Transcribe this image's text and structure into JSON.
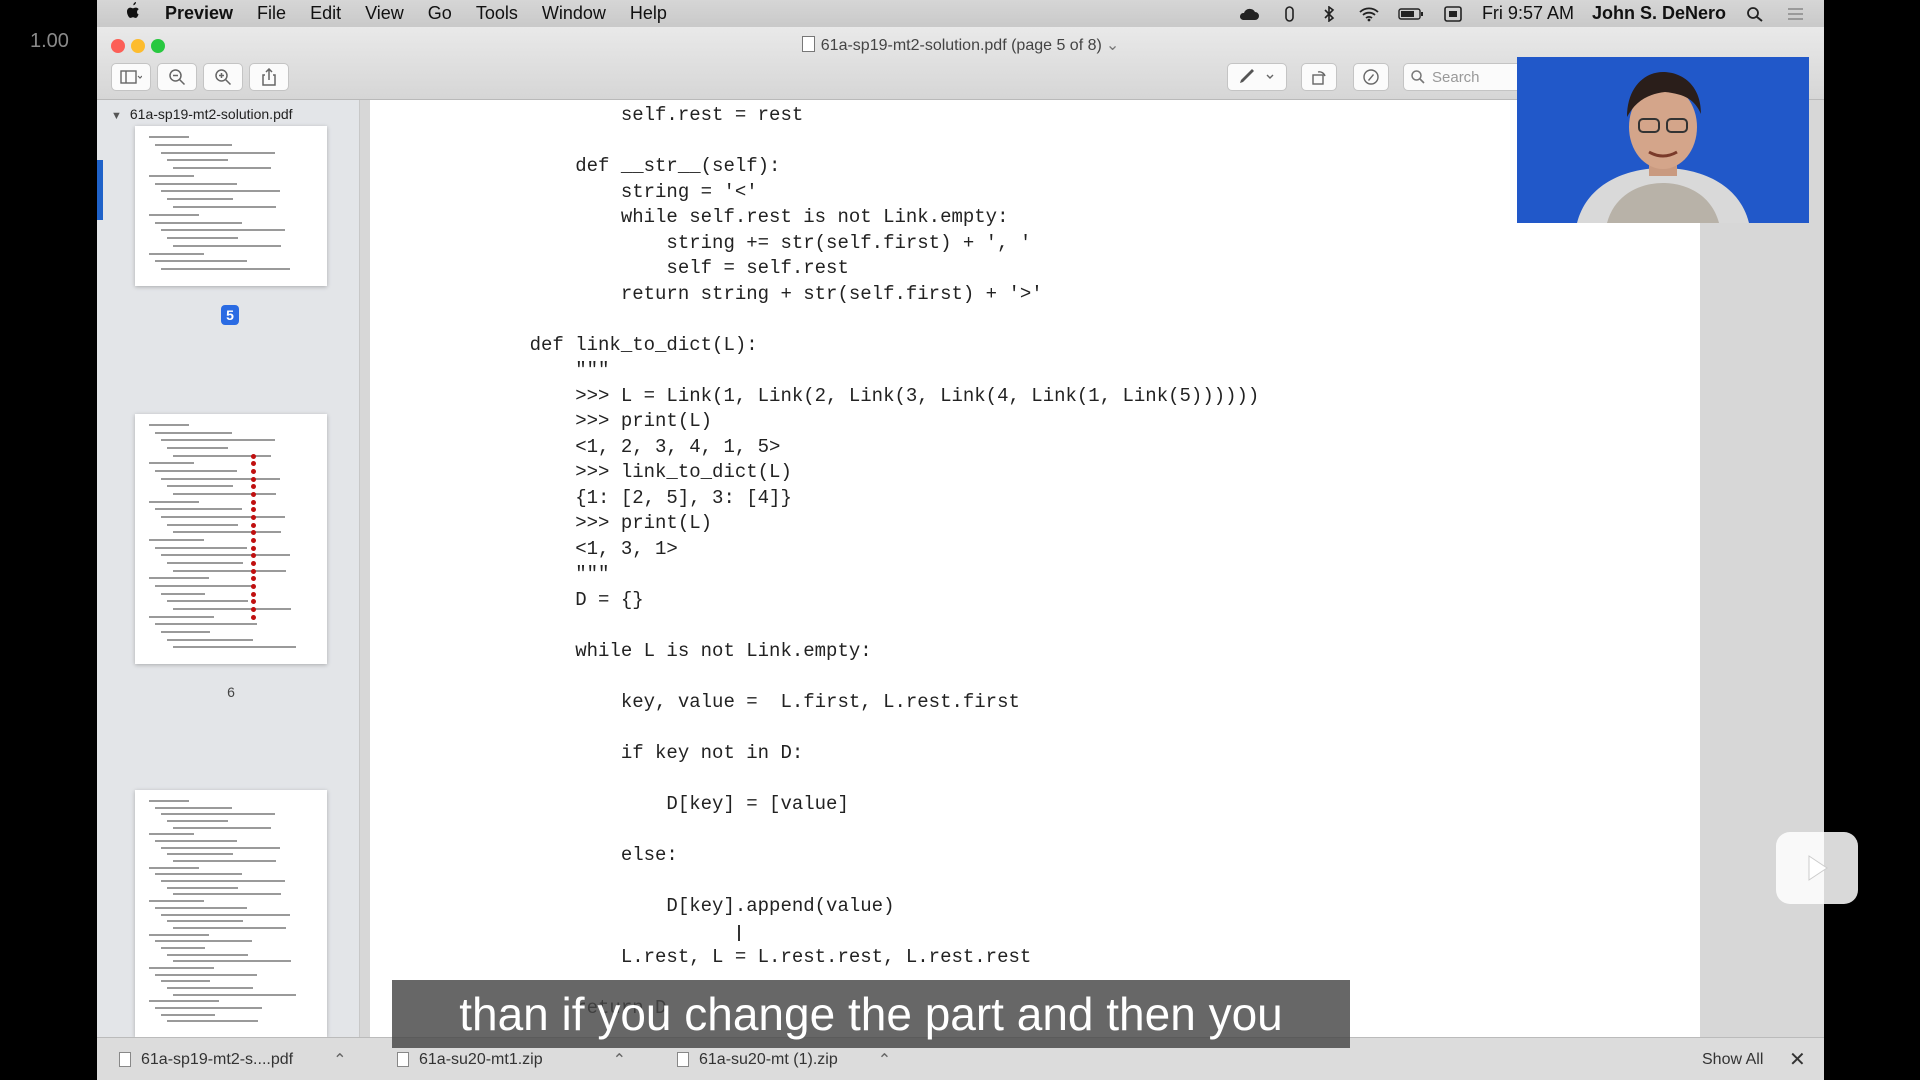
{
  "playback": {
    "speed": "1.00"
  },
  "menubar": {
    "app": "Preview",
    "items": [
      "File",
      "Edit",
      "View",
      "Go",
      "Tools",
      "Window",
      "Help"
    ],
    "clock": "Fri 9:57 AM",
    "user": "John S. DeNero"
  },
  "window": {
    "title": "61a-sp19-mt2-solution.pdf (page 5 of 8)",
    "search_placeholder": "Search"
  },
  "sidebar": {
    "file": "61a-sp19-mt2-solution.pdf",
    "pages": [
      {
        "label": "5",
        "selected": true
      },
      {
        "label": "6",
        "selected": false
      }
    ]
  },
  "code": {
    "lines": [
      "            self.rest = rest",
      "",
      "        def __str__(self):",
      "            string = '<'",
      "            while self.rest is not Link.empty:",
      "                string += str(self.first) + ', '",
      "                self = self.rest",
      "            return string + str(self.first) + '>'",
      "",
      "    def link_to_dict(L):",
      "        \"\"\"",
      "        >>> L = Link(1, Link(2, Link(3, Link(4, Link(1, Link(5))))))",
      "        >>> print(L)",
      "        <1, 2, 3, 4, 1, 5>",
      "        >>> link_to_dict(L)",
      "        {1: [2, 5], 3: [4]}",
      "        >>> print(L)",
      "        <1, 3, 1>",
      "        \"\"\"",
      "        D = {}",
      "",
      "        while L is not Link.empty:",
      "",
      "            key, value =  L.first, L.rest.first",
      "",
      "            if key not in D:",
      "",
      "                D[key] = [value]",
      "",
      "            else:",
      "",
      "                D[key].append(value)",
      "",
      "            L.rest, L = L.rest.rest, L.rest.rest",
      "",
      "        return D"
    ]
  },
  "caption": "than if you change the part and then you",
  "downloads": {
    "items": [
      "61a-sp19-mt2-s....pdf",
      "61a-su20-mt1.zip",
      "61a-su20-mt (1).zip"
    ],
    "show_all": "Show All",
    "close": "✕"
  }
}
